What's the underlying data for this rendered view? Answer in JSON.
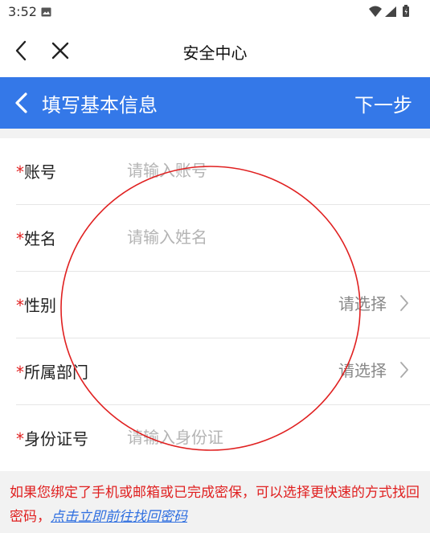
{
  "status_bar": {
    "time": "3:52"
  },
  "nav": {
    "title": "安全中心"
  },
  "header": {
    "title": "填写基本信息",
    "next_label": "下一步"
  },
  "form": {
    "required_mark": "*",
    "fields": [
      {
        "label": "账号",
        "placeholder": "请输入账号"
      },
      {
        "label": "姓名",
        "placeholder": "请输入姓名"
      },
      {
        "label": "性别",
        "select_value": "请选择"
      },
      {
        "label": "所属部门",
        "select_value": "请选择"
      },
      {
        "label": "身份证号",
        "placeholder": "请输入身份证"
      }
    ]
  },
  "tip": {
    "text": "如果您绑定了手机或邮箱或已完成密保，可以选择更快速的方式找回密码，",
    "link": "点击立即前往找回密码"
  },
  "colors": {
    "header_bg": "#3478e8",
    "required": "#e02020",
    "link": "#2f6fe0",
    "annotation": "#e02020"
  }
}
